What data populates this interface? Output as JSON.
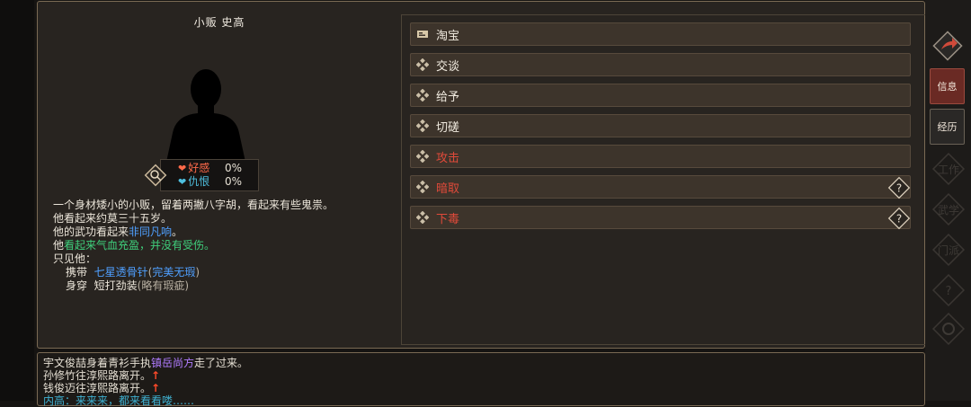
{
  "npc": {
    "name": "小贩 史高",
    "favor_label": "好感",
    "favor_value": "0%",
    "hatred_label": "仇恨",
    "hatred_value": "0%"
  },
  "description": {
    "line1": "一个身材矮小的小贩，留着两撇八字胡，看起来有些鬼祟。",
    "line2": "他看起来约莫三十五岁。",
    "line3_prefix": "他的武功看起来",
    "line3_highlight": "非同凡响",
    "line3_suffix": "。",
    "line4_prefix": "他",
    "line4_highlight": "看起来气血充盈，并没有受伤。",
    "line5": "只见他：",
    "carry_label": "携带",
    "carry_item": "七星透骨针",
    "carry_open": "(",
    "carry_quality": "完美无瑕",
    "carry_close": ")",
    "wear_label": "身穿",
    "wear_item": "短打劲装",
    "wear_quality": "(略有瑕疵)"
  },
  "menu": {
    "items": [
      {
        "label": "淘宝",
        "icon": "treasure-icon"
      },
      {
        "label": "交谈",
        "icon": "diamond-icon"
      },
      {
        "label": "给予",
        "icon": "diamond-icon"
      },
      {
        "label": "切磋",
        "icon": "diamond-icon"
      },
      {
        "label": "攻击",
        "icon": "diamond-icon"
      },
      {
        "label": "暗取",
        "icon": "diamond-icon"
      },
      {
        "label": "下毒",
        "icon": "diamond-icon"
      }
    ]
  },
  "sidebar": {
    "info_label": "信息",
    "exp_label": "经历",
    "ghost1": "工作",
    "ghost2": "武学",
    "ghost3": "门派"
  },
  "log": {
    "l1_a": "宇文俊喆身着青衫手执",
    "l1_b": "镇岳尚方",
    "l1_c": "走了过来。",
    "l2": "孙修竹往淳熙路离开。",
    "l3": "钱俊迈往淳熙路离开。",
    "arrow": "↑",
    "l4": "内高：来来来，都来看看喽……"
  },
  "colors": {
    "accent_red": "#e04a3a",
    "blue": "#4fa0ff",
    "green": "#3fd07c",
    "purple": "#b07cff",
    "favor": "#ff6a4a",
    "hatred": "#4fc0e0"
  }
}
